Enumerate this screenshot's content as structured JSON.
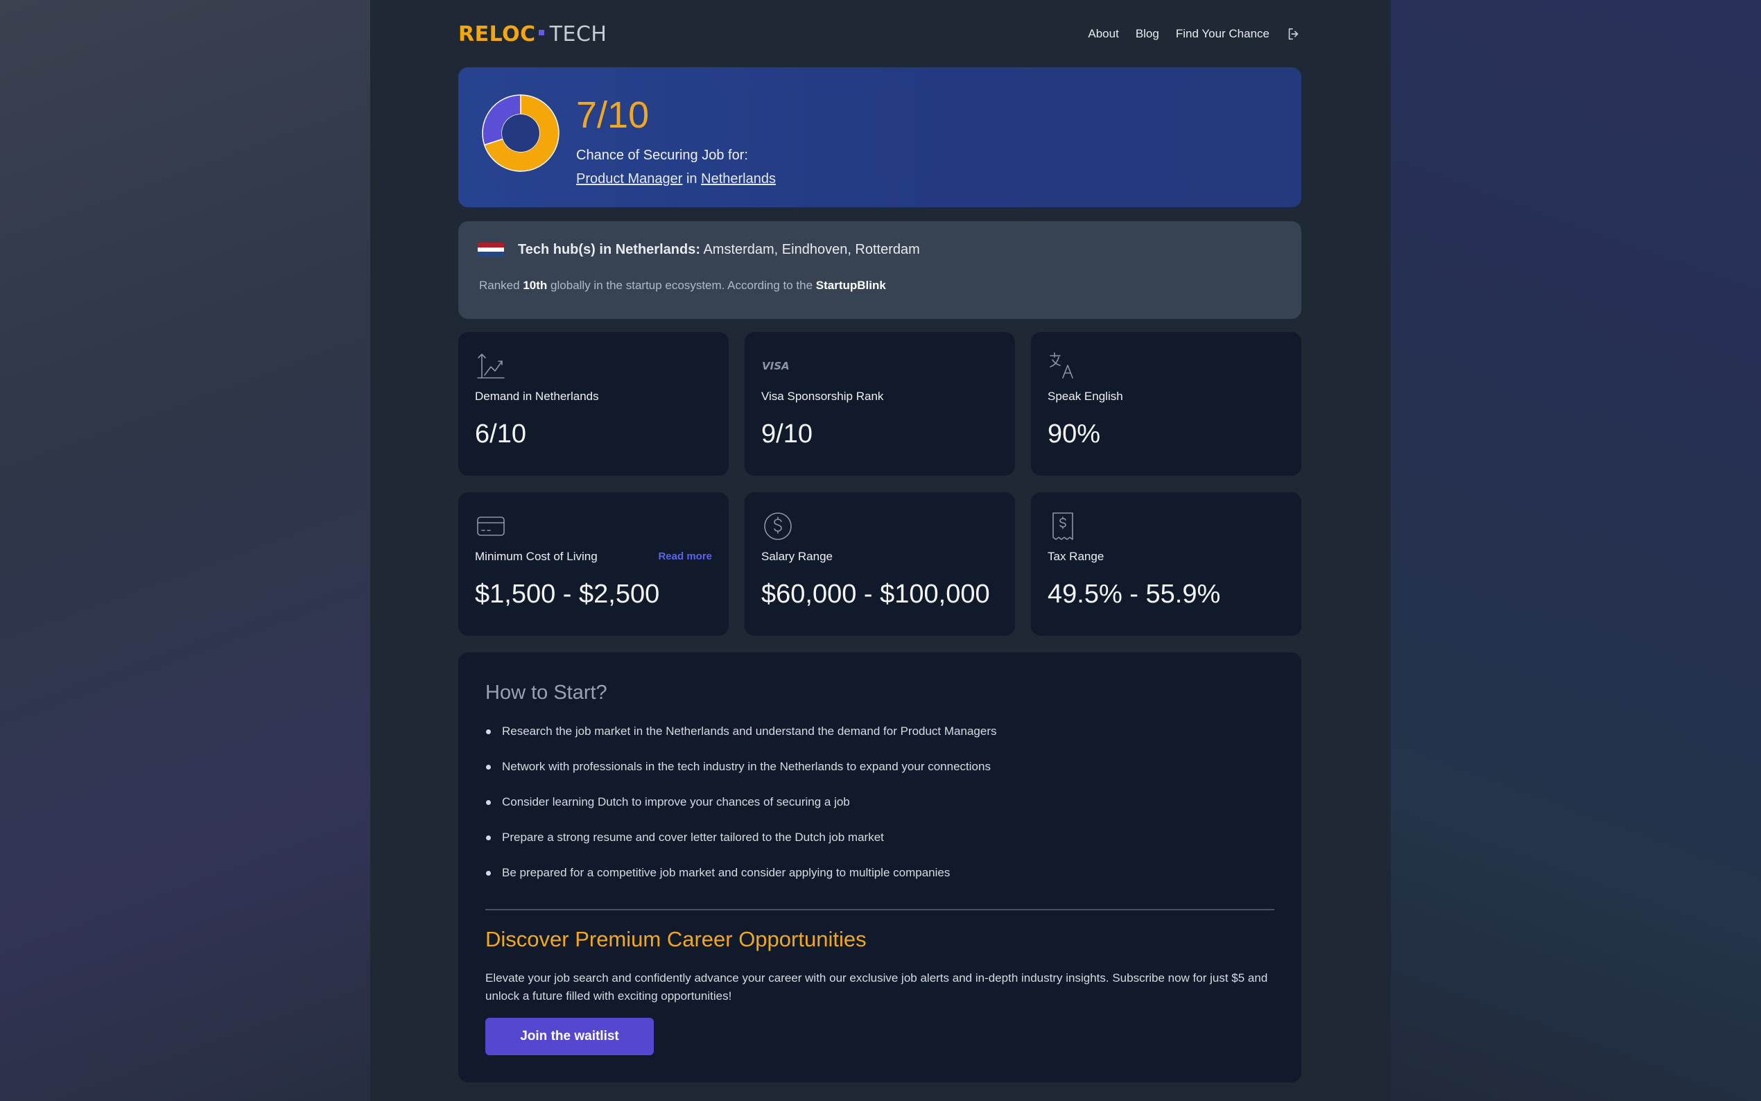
{
  "brand": {
    "part1": "RELOC",
    "part2": "TECH"
  },
  "nav": {
    "about": "About",
    "blog": "Blog",
    "find": "Find Your Chance"
  },
  "score": {
    "value": "7/10",
    "fraction": 0.7,
    "subtitle": "Chance of Securing Job for:",
    "role": "Product Manager",
    "connector": "in",
    "country": "Netherlands",
    "colors": {
      "filled": "#f5a70a",
      "remaining": "#5a4fd6",
      "hole": "#233a80"
    }
  },
  "hub": {
    "title": "Tech hub(s) in Netherlands:",
    "cities": "Amsterdam, Eindhoven, Rotterdam",
    "rank_prefix": "Ranked",
    "rank": "10th",
    "rank_suffix": "globally in the startup ecosystem. According to the",
    "source": "StartupBlink",
    "flag_colors": [
      "#ae1c28",
      "#ffffff",
      "#21468b"
    ]
  },
  "stats": {
    "demand": {
      "icon": "trending-up-icon",
      "label": "Demand in Netherlands",
      "value": "6/10"
    },
    "visa": {
      "icon": "visa-icon",
      "icon_text": "VISA",
      "label": "Visa Sponsorship Rank",
      "value": "9/10"
    },
    "english": {
      "icon": "language-icon",
      "label": "Speak English",
      "value": "90%"
    },
    "cost": {
      "icon": "credit-card-icon",
      "label": "Minimum Cost of Living",
      "read_more": "Read more",
      "value": "$1,500 - $2,500"
    },
    "salary": {
      "icon": "dollar-circle-icon",
      "label": "Salary Range",
      "value": "$60,000 - $100,000"
    },
    "tax": {
      "icon": "receipt-icon",
      "label": "Tax Range",
      "value": "49.5% - 55.9%"
    }
  },
  "how": {
    "title": "How to Start?",
    "steps": [
      "Research the job market in the Netherlands and understand the demand for Product Managers",
      "Network with professionals in the tech industry in the Netherlands to expand your connections",
      "Consider learning Dutch to improve your chances of securing a job",
      "Prepare a strong resume and cover letter tailored to the Dutch job market",
      "Be prepared for a competitive job market and consider applying to multiple companies"
    ]
  },
  "premium": {
    "title": "Discover Premium Career Opportunities",
    "text": "Elevate your job search and confidently advance your career with our exclusive job alerts and in-depth industry insights. Subscribe now for just $5 and unlock a future filled with exciting opportunities!",
    "button": "Join the waitlist"
  }
}
